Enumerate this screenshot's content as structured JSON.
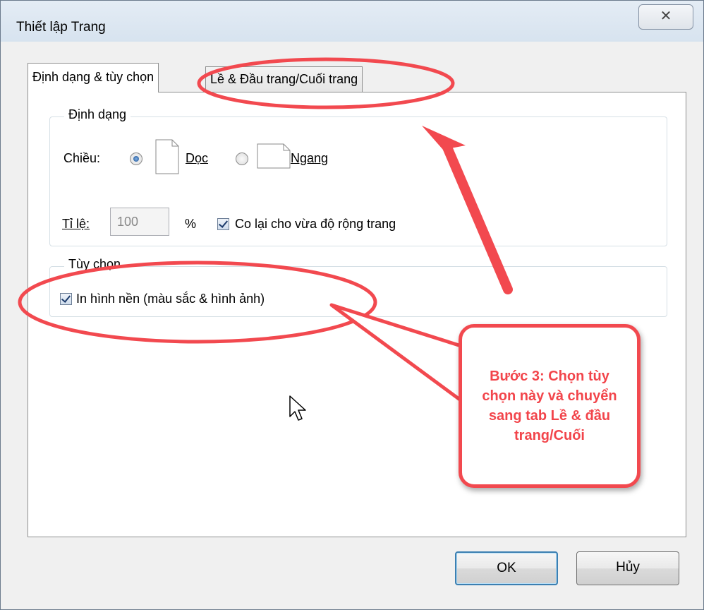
{
  "window": {
    "title": "Thiết lập Trang",
    "close_glyph": "✕"
  },
  "tabs": [
    {
      "label": "Định dạng & tùy chọn"
    },
    {
      "label": "Lề & Đầu trang/Cuối trang"
    }
  ],
  "format_group": {
    "legend": "Định dạng",
    "orientation_label": "Chiều:",
    "portrait": {
      "label": "Dọc",
      "checked": true
    },
    "landscape": {
      "label": "Ngang",
      "checked": false
    },
    "scale_label": "Tỉ lệ:",
    "scale_value": "100",
    "percent": "%",
    "shrink_to_fit": {
      "label": "Co lại cho vừa độ rộng trang",
      "checked": true
    }
  },
  "options_group": {
    "legend": "Tùy chọn",
    "print_background": {
      "label": "In hình nền (màu sắc & hình ảnh)",
      "checked": true
    }
  },
  "buttons": {
    "ok": "OK",
    "cancel": "Hủy"
  },
  "annotation": {
    "text": "Bước 3: Chọn tùy chọn này và chuyển sang tab Lề & đầu trang/Cuối",
    "color": "#f2454b"
  }
}
